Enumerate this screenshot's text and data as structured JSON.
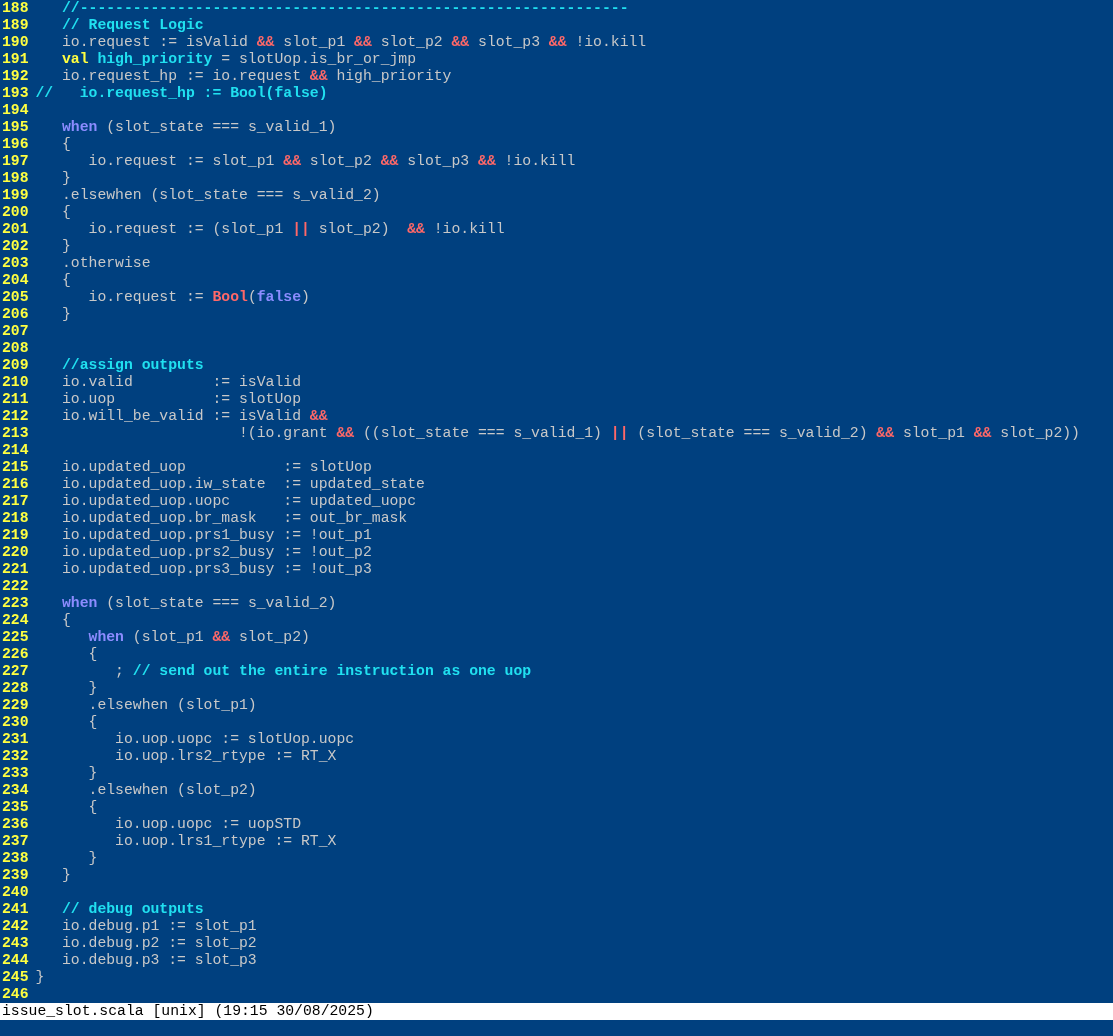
{
  "editor": {
    "lines": [
      {
        "number": "188",
        "tokens": [
          {
            "kind": "comment",
            "text": "   //--------------------------------------------------------------"
          }
        ]
      },
      {
        "number": "189",
        "tokens": [
          {
            "kind": "comment",
            "text": "   // Request Logic"
          }
        ]
      },
      {
        "number": "190",
        "tokens": [
          {
            "kind": "plain",
            "text": "   io.request := isValid "
          },
          {
            "kind": "operator",
            "text": "&&"
          },
          {
            "kind": "plain",
            "text": " slot_p1 "
          },
          {
            "kind": "operator",
            "text": "&&"
          },
          {
            "kind": "plain",
            "text": " slot_p2 "
          },
          {
            "kind": "operator",
            "text": "&&"
          },
          {
            "kind": "plain",
            "text": " slot_p3 "
          },
          {
            "kind": "operator",
            "text": "&&"
          },
          {
            "kind": "plain",
            "text": " !io.kill"
          }
        ]
      },
      {
        "number": "191",
        "tokens": [
          {
            "kind": "statement",
            "text": "   val"
          },
          {
            "kind": "identifier",
            "text": " high_priority"
          },
          {
            "kind": "plain",
            "text": " = slotUop.is_br_or_jmp"
          }
        ]
      },
      {
        "number": "192",
        "tokens": [
          {
            "kind": "plain",
            "text": "   io.request_hp := io.request "
          },
          {
            "kind": "operator",
            "text": "&&"
          },
          {
            "kind": "plain",
            "text": " high_priority"
          }
        ]
      },
      {
        "number": "193",
        "tokens": [
          {
            "kind": "comment",
            "text": "//   io.request_hp := Bool(false)"
          }
        ]
      },
      {
        "number": "194"
      },
      {
        "number": "195",
        "tokens": [
          {
            "kind": "keyword",
            "text": "   when"
          },
          {
            "kind": "plain",
            "text": " (slot_state === s_valid_1)"
          }
        ]
      },
      {
        "number": "196",
        "tokens": [
          {
            "kind": "plain",
            "text": "   {"
          }
        ]
      },
      {
        "number": "197",
        "tokens": [
          {
            "kind": "plain",
            "text": "      io.request := slot_p1 "
          },
          {
            "kind": "operator",
            "text": "&&"
          },
          {
            "kind": "plain",
            "text": " slot_p2 "
          },
          {
            "kind": "operator",
            "text": "&&"
          },
          {
            "kind": "plain",
            "text": " slot_p3 "
          },
          {
            "kind": "operator",
            "text": "&&"
          },
          {
            "kind": "plain",
            "text": " !io.kill"
          }
        ]
      },
      {
        "number": "198",
        "tokens": [
          {
            "kind": "plain",
            "text": "   }"
          }
        ]
      },
      {
        "number": "199",
        "tokens": [
          {
            "kind": "plain",
            "text": "   .elsewhen (slot_state === s_valid_2)"
          }
        ]
      },
      {
        "number": "200",
        "tokens": [
          {
            "kind": "plain",
            "text": "   {"
          }
        ]
      },
      {
        "number": "201",
        "tokens": [
          {
            "kind": "plain",
            "text": "      io.request := (slot_p1 "
          },
          {
            "kind": "operator",
            "text": "||"
          },
          {
            "kind": "plain",
            "text": " slot_p2)  "
          },
          {
            "kind": "operator",
            "text": "&&"
          },
          {
            "kind": "plain",
            "text": " !io.kill"
          }
        ]
      },
      {
        "number": "202",
        "tokens": [
          {
            "kind": "plain",
            "text": "   }"
          }
        ]
      },
      {
        "number": "203",
        "tokens": [
          {
            "kind": "plain",
            "text": "   .otherwise"
          }
        ]
      },
      {
        "number": "204",
        "tokens": [
          {
            "kind": "plain",
            "text": "   {"
          }
        ]
      },
      {
        "number": "205",
        "tokens": [
          {
            "kind": "plain",
            "text": "      io.request := "
          },
          {
            "kind": "type",
            "text": "Bool"
          },
          {
            "kind": "plain",
            "text": "("
          },
          {
            "kind": "boolean",
            "text": "false"
          },
          {
            "kind": "plain",
            "text": ")"
          }
        ]
      },
      {
        "number": "206",
        "tokens": [
          {
            "kind": "plain",
            "text": "   }"
          }
        ]
      },
      {
        "number": "207"
      },
      {
        "number": "208"
      },
      {
        "number": "209",
        "tokens": [
          {
            "kind": "comment",
            "text": "   //assign outputs"
          }
        ]
      },
      {
        "number": "210",
        "tokens": [
          {
            "kind": "plain",
            "text": "   io.valid         := isValid"
          }
        ]
      },
      {
        "number": "211",
        "tokens": [
          {
            "kind": "plain",
            "text": "   io.uop           := slotUop"
          }
        ]
      },
      {
        "number": "212",
        "tokens": [
          {
            "kind": "plain",
            "text": "   io.will_be_valid := isValid "
          },
          {
            "kind": "operator",
            "text": "&&"
          }
        ]
      },
      {
        "number": "213",
        "tokens": [
          {
            "kind": "plain",
            "text": "                       !(io.grant "
          },
          {
            "kind": "operator",
            "text": "&&"
          },
          {
            "kind": "plain",
            "text": " ((slot_state === s_valid_1) "
          },
          {
            "kind": "operator",
            "text": "||"
          },
          {
            "kind": "plain",
            "text": " (slot_state === s_valid_2) "
          },
          {
            "kind": "operator",
            "text": "&&"
          },
          {
            "kind": "plain",
            "text": " slot_p1 "
          },
          {
            "kind": "operator",
            "text": "&&"
          },
          {
            "kind": "plain",
            "text": " slot_p2))"
          }
        ]
      },
      {
        "number": "214"
      },
      {
        "number": "215",
        "tokens": [
          {
            "kind": "plain",
            "text": "   io.updated_uop           := slotUop"
          }
        ]
      },
      {
        "number": "216",
        "tokens": [
          {
            "kind": "plain",
            "text": "   io.updated_uop.iw_state  := updated_state"
          }
        ]
      },
      {
        "number": "217",
        "tokens": [
          {
            "kind": "plain",
            "text": "   io.updated_uop.uopc      := updated_uopc"
          }
        ]
      },
      {
        "number": "218",
        "tokens": [
          {
            "kind": "plain",
            "text": "   io.updated_uop.br_mask   := out_br_mask"
          }
        ]
      },
      {
        "number": "219",
        "tokens": [
          {
            "kind": "plain",
            "text": "   io.updated_uop.prs1_busy := !out_p1"
          }
        ]
      },
      {
        "number": "220",
        "tokens": [
          {
            "kind": "plain",
            "text": "   io.updated_uop.prs2_busy := !out_p2"
          }
        ]
      },
      {
        "number": "221",
        "tokens": [
          {
            "kind": "plain",
            "text": "   io.updated_uop.prs3_busy := !out_p3"
          }
        ]
      },
      {
        "number": "222"
      },
      {
        "number": "223",
        "tokens": [
          {
            "kind": "keyword",
            "text": "   when"
          },
          {
            "kind": "plain",
            "text": " (slot_state === s_valid_2)"
          }
        ]
      },
      {
        "number": "224",
        "tokens": [
          {
            "kind": "plain",
            "text": "   {"
          }
        ]
      },
      {
        "number": "225",
        "tokens": [
          {
            "kind": "keyword",
            "text": "      when"
          },
          {
            "kind": "plain",
            "text": " (slot_p1 "
          },
          {
            "kind": "operator",
            "text": "&&"
          },
          {
            "kind": "plain",
            "text": " slot_p2)"
          }
        ]
      },
      {
        "number": "226",
        "tokens": [
          {
            "kind": "plain",
            "text": "      {"
          }
        ]
      },
      {
        "number": "227",
        "tokens": [
          {
            "kind": "plain",
            "text": "         ; "
          },
          {
            "kind": "comment",
            "text": "// send out the entire instruction as one uop"
          }
        ]
      },
      {
        "number": "228",
        "tokens": [
          {
            "kind": "plain",
            "text": "      }"
          }
        ]
      },
      {
        "number": "229",
        "tokens": [
          {
            "kind": "plain",
            "text": "      .elsewhen (slot_p1)"
          }
        ]
      },
      {
        "number": "230",
        "tokens": [
          {
            "kind": "plain",
            "text": "      {"
          }
        ]
      },
      {
        "number": "231",
        "tokens": [
          {
            "kind": "plain",
            "text": "         io.uop.uopc := slotUop.uopc"
          }
        ]
      },
      {
        "number": "232",
        "tokens": [
          {
            "kind": "plain",
            "text": "         io.uop.lrs2_rtype := RT_X"
          }
        ]
      },
      {
        "number": "233",
        "tokens": [
          {
            "kind": "plain",
            "text": "      }"
          }
        ]
      },
      {
        "number": "234",
        "tokens": [
          {
            "kind": "plain",
            "text": "      .elsewhen (slot_p2)"
          }
        ]
      },
      {
        "number": "235",
        "tokens": [
          {
            "kind": "plain",
            "text": "      {"
          }
        ]
      },
      {
        "number": "236",
        "tokens": [
          {
            "kind": "plain",
            "text": "         io.uop.uopc := uopSTD"
          }
        ]
      },
      {
        "number": "237",
        "tokens": [
          {
            "kind": "plain",
            "text": "         io.uop.lrs1_rtype := RT_X"
          }
        ]
      },
      {
        "number": "238",
        "tokens": [
          {
            "kind": "plain",
            "text": "      }"
          }
        ]
      },
      {
        "number": "239",
        "tokens": [
          {
            "kind": "plain",
            "text": "   }"
          }
        ]
      },
      {
        "number": "240"
      },
      {
        "number": "241",
        "tokens": [
          {
            "kind": "comment",
            "text": "   // debug outputs"
          }
        ]
      },
      {
        "number": "242",
        "tokens": [
          {
            "kind": "plain",
            "text": "   io.debug.p1 := slot_p1"
          }
        ]
      },
      {
        "number": "243",
        "tokens": [
          {
            "kind": "plain",
            "text": "   io.debug.p2 := slot_p2"
          }
        ]
      },
      {
        "number": "244",
        "tokens": [
          {
            "kind": "plain",
            "text": "   io.debug.p3 := slot_p3"
          }
        ]
      },
      {
        "number": "245",
        "tokens": [
          {
            "kind": "plain",
            "text": "}"
          }
        ]
      },
      {
        "number": "246"
      }
    ]
  },
  "status_bar": {
    "text": "issue_slot.scala [unix] (19:15 30/08/2025)"
  }
}
